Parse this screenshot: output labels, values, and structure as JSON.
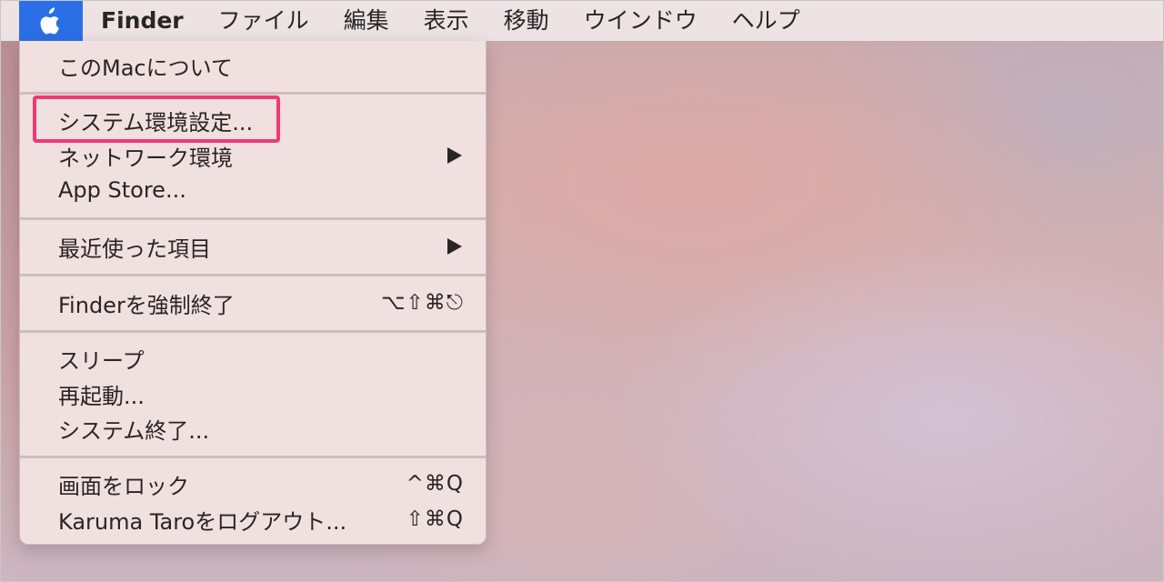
{
  "menubar": {
    "apple_icon": "apple-logo-icon",
    "app_name": "Finder",
    "items": [
      "ファイル",
      "編集",
      "表示",
      "移動",
      "ウインドウ",
      "ヘルプ"
    ]
  },
  "apple_menu": {
    "items": [
      {
        "label": "このMacについて"
      },
      {
        "label": "システム環境設定..."
      },
      {
        "label": "ネットワーク環境",
        "submenu_icon": "submenu-arrow-icon"
      },
      {
        "label": "App Store..."
      },
      {
        "label": "最近使った項目",
        "submenu_icon": "submenu-arrow-icon"
      },
      {
        "label": "Finderを強制終了",
        "shortcut": "⌥⇧⌘⎋"
      },
      {
        "label": "スリープ"
      },
      {
        "label": "再起動..."
      },
      {
        "label": "システム終了..."
      },
      {
        "label": "画面をロック",
        "shortcut": "^⌘Q"
      },
      {
        "label": "Karuma Taroをログアウト...",
        "shortcut": "⇧⌘Q"
      }
    ],
    "highlighted_item": "システム環境設定...",
    "highlight_color": "#ee3a78"
  },
  "colors": {
    "apple_button_bg": "#2a6fe6",
    "menu_text": "#2b2424"
  }
}
